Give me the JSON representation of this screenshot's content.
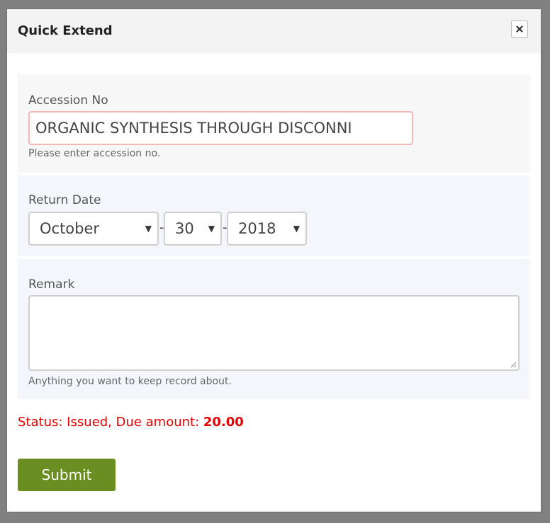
{
  "dialog": {
    "title": "Quick Extend",
    "close_icon": "close-icon"
  },
  "accession": {
    "label": "Accession No",
    "value": "ORGANIC SYNTHESIS THROUGH DISCONNI",
    "help": "Please enter accession no."
  },
  "return_date": {
    "label": "Return Date",
    "month": "October",
    "day": "30",
    "year": "2018",
    "separator": "-",
    "caret": "▼"
  },
  "remark": {
    "label": "Remark",
    "value": "",
    "help": "Anything you want to keep record about."
  },
  "status": {
    "prefix": "Status: Issued, Due amount: ",
    "amount": "20.00"
  },
  "submit_label": "Submit",
  "colors": {
    "overlay": "#808080",
    "header_bg": "#f3f3f3",
    "status_red": "#e60000",
    "submit_green": "#6b8e23",
    "input_error_border": "#f2b8b8"
  }
}
